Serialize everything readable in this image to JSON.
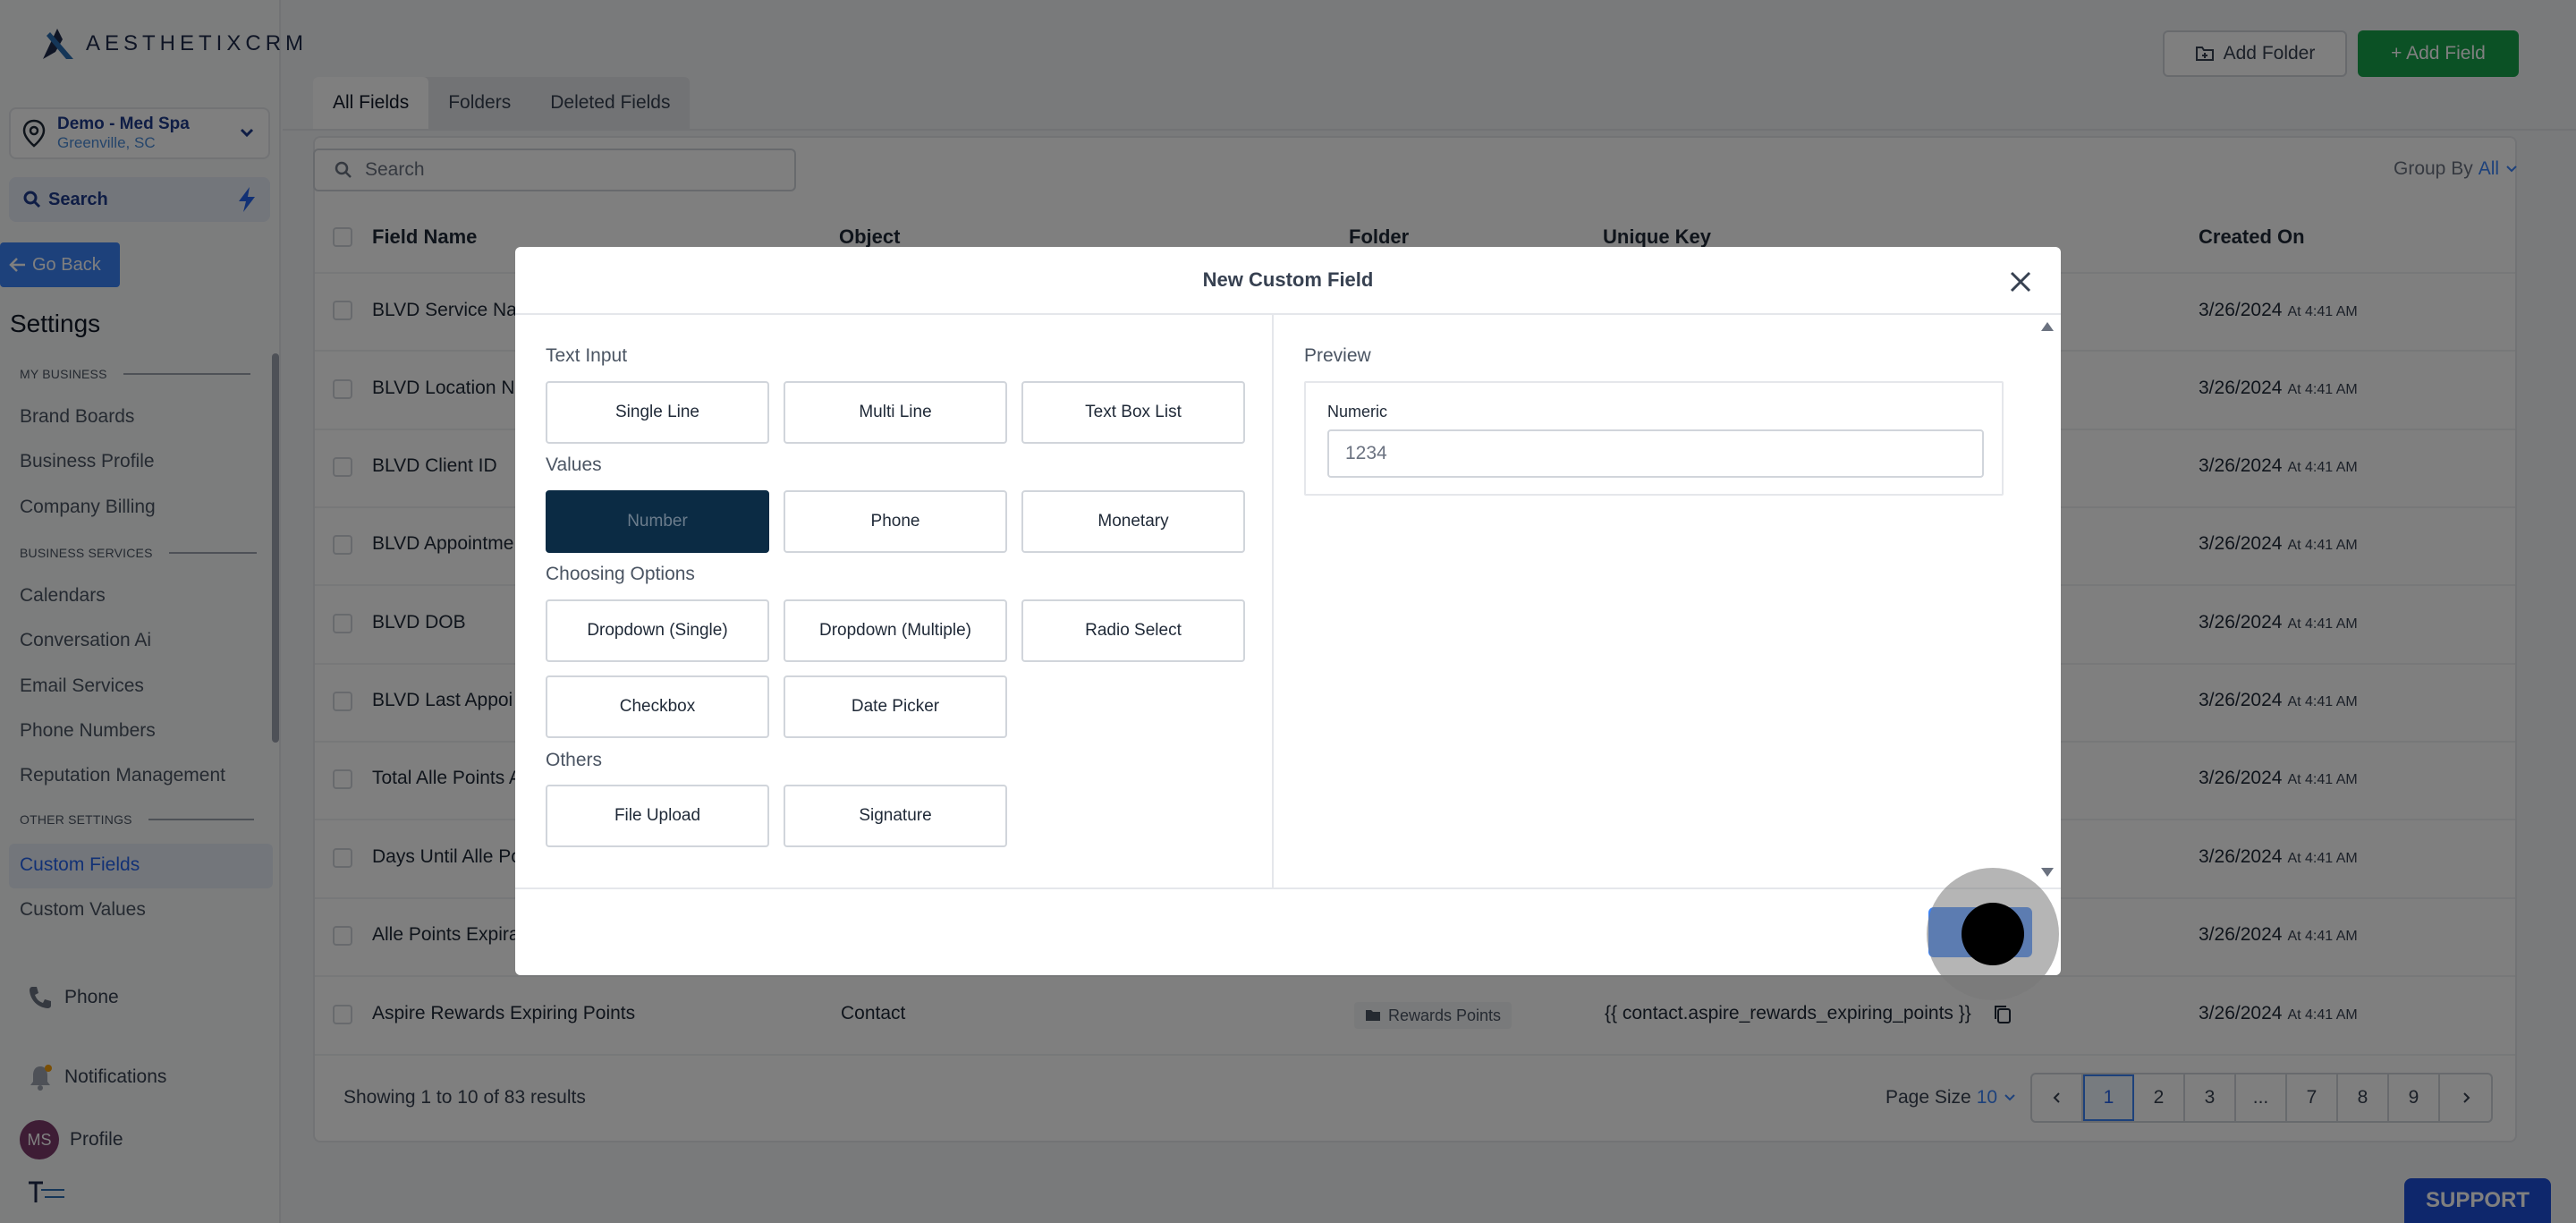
{
  "brand": {
    "name": "AESTHETIXCRM"
  },
  "location": {
    "name": "Demo - Med Spa",
    "city": "Greenville, SC"
  },
  "sidebar": {
    "search_label": "Search",
    "go_back": "Go Back",
    "settings_title": "Settings",
    "sections": {
      "my_business": "MY BUSINESS",
      "business_services": "BUSINESS SERVICES",
      "other_settings": "OTHER SETTINGS"
    },
    "items": {
      "brand_boards": "Brand Boards",
      "business_profile": "Business Profile",
      "company_billing": "Company Billing",
      "calendars": "Calendars",
      "conversation_ai": "Conversation Ai",
      "email_services": "Email Services",
      "phone_numbers": "Phone Numbers",
      "reputation_management": "Reputation Management",
      "custom_fields": "Custom Fields",
      "custom_values": "Custom Values"
    },
    "bottom": {
      "phone": "Phone",
      "notifications": "Notifications",
      "profile": "Profile",
      "avatar_initials": "MS"
    }
  },
  "header": {
    "add_folder": "Add Folder",
    "add_field": "+ Add Field"
  },
  "tabs": [
    "All Fields",
    "Folders",
    "Deleted Fields"
  ],
  "search": {
    "placeholder": "Search"
  },
  "group_by": {
    "label": "Group By",
    "value": "All"
  },
  "table": {
    "columns": [
      "Field Name",
      "Object",
      "Folder",
      "Unique Key",
      "Created On"
    ],
    "rows": [
      {
        "name": "BLVD Service Na",
        "date": "3/26/2024",
        "time": "At 4:41 AM"
      },
      {
        "name": "BLVD Location N",
        "date": "3/26/2024",
        "time": "At 4:41 AM"
      },
      {
        "name": "BLVD Client ID",
        "date": "3/26/2024",
        "time": "At 4:41 AM"
      },
      {
        "name": "BLVD Appointme",
        "date": "3/26/2024",
        "time": "At 4:41 AM"
      },
      {
        "name": "BLVD DOB",
        "date": "3/26/2024",
        "time": "At 4:41 AM"
      },
      {
        "name": "BLVD Last Appoi",
        "date": "3/26/2024",
        "time": "At 4:41 AM"
      },
      {
        "name": "Total Alle Points A",
        "date": "3/26/2024",
        "time": "At 4:41 AM"
      },
      {
        "name": "Days Until Alle Po",
        "date": "3/26/2024",
        "time": "At 4:41 AM"
      },
      {
        "name": "Alle Points Expira",
        "date": "3/26/2024",
        "time": "At 4:41 AM"
      },
      {
        "name": "Aspire Rewards Expiring Points",
        "object": "Contact",
        "folder": "Rewards Points",
        "key": "{{ contact.aspire_rewards_expiring_points }}",
        "date": "3/26/2024",
        "time": "At 4:41 AM"
      }
    ]
  },
  "pagination": {
    "showing": "Showing 1 to 10 of 83 results",
    "page_size_label": "Page Size",
    "page_size_value": "10",
    "pages": [
      "1",
      "2",
      "3",
      "...",
      "7",
      "8",
      "9"
    ]
  },
  "support": "SUPPORT",
  "modal": {
    "title": "New Custom Field",
    "groups": {
      "text_input": {
        "label": "Text Input",
        "options": [
          "Single Line",
          "Multi Line",
          "Text Box List"
        ]
      },
      "values": {
        "label": "Values",
        "options": [
          "Number",
          "Phone",
          "Monetary"
        ]
      },
      "choosing": {
        "label": "Choosing Options",
        "options": [
          "Dropdown (Single)",
          "Dropdown (Multiple)",
          "Radio Select",
          "Checkbox",
          "Date Picker"
        ]
      },
      "others": {
        "label": "Others",
        "options": [
          "File Upload",
          "Signature"
        ]
      }
    },
    "selected_option": "Number",
    "preview": {
      "label": "Preview",
      "field_label": "Numeric",
      "placeholder": "1234"
    }
  },
  "colors": {
    "accent": "#3b82f6",
    "primary_green": "#16a34a",
    "selected_option": "#0b2b44"
  }
}
